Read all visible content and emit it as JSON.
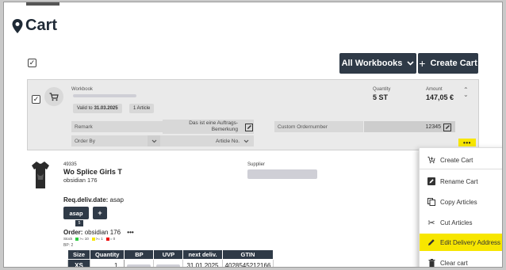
{
  "page": {
    "title": "Cart",
    "title_icon": "map-pin-icon"
  },
  "toolbar": {
    "all_workbooks_label": "All Workbooks",
    "create_cart_label": "Create Cart"
  },
  "workbook": {
    "label": "Workbook",
    "valid_to_label": "Valid to",
    "valid_to_date": "31.03.2025",
    "article_count": "1 Article",
    "quantity_label": "Quantity",
    "quantity_value": "5 ST",
    "amount_label": "Amount",
    "amount_value": "147,05 €",
    "remark_placeholder": "Remark",
    "order_by_placeholder": "Order By",
    "auftrag_text": "Das ist eine Auftrags-Bemerkung",
    "sort_value": "Article No.",
    "custom_ordernumber_placeholder": "Custom Ordernumber",
    "custom_ordernumber_value": "12345",
    "more_label": "•••"
  },
  "article": {
    "number": "49335",
    "name": "Wo Splice Girls T",
    "color": "obsidian 176",
    "supplier_label": "Supplier",
    "req_deliv_label": "Req.deliv.date:",
    "req_deliv_value": "asap",
    "asap_button": "asap",
    "plus_button": "+",
    "badge": "5",
    "order_label": "Order:",
    "order_value": "obsidian 176",
    "order_more": "•••",
    "legend_stock": "Stock",
    "legend_1": ">= 10",
    "legend_2": ">= 1",
    "legend_3": "= 0",
    "bp_line": "BP: 2",
    "table": {
      "headers": [
        "Size",
        "Quantity",
        "BP",
        "UVP",
        "next deliv.",
        "GTIN"
      ],
      "row": {
        "size": "XS",
        "quantity": "1",
        "bp": "",
        "uvp": "",
        "next_deliv": "31.01.2025",
        "gtin": "4028545212166"
      }
    }
  },
  "context_menu": {
    "items": [
      {
        "label": "Create Cart",
        "icon": "cart-plus-icon"
      },
      {
        "label": "Rename Cart",
        "icon": "edit-square-icon"
      },
      {
        "label": "Copy Articles",
        "icon": "copy-icon"
      },
      {
        "label": "Cut Articles",
        "icon": "scissors-icon"
      },
      {
        "label": "Edit Delivery Address",
        "icon": "pencil-icon",
        "highlighted": true
      },
      {
        "label": "Clear cart",
        "icon": "trash-icon"
      }
    ]
  },
  "colors": {
    "dark_button": "#2f3a47",
    "highlight": "#f7e600",
    "card_bg": "#eaeaea"
  }
}
